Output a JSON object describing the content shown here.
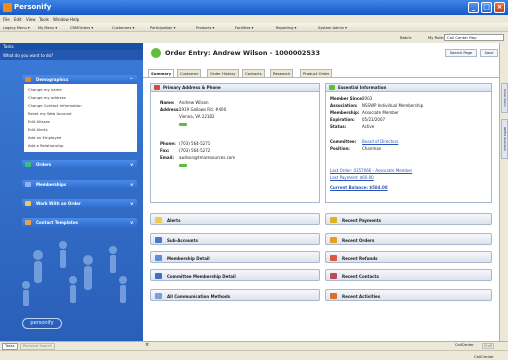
{
  "app": {
    "title": "Personify"
  },
  "menu": [
    "File",
    "Edit",
    "View",
    "Tools",
    "Window",
    "Help"
  ],
  "toolbar": {
    "items": [
      "Legacy Menu ▾",
      "My Menu ▾",
      "CRMOrders ▾",
      "Customers ▾",
      "Participation ▾",
      "Products ▾",
      "Facilities ▾",
      "Reporting ▾",
      "System Admin ▾"
    ],
    "batch_label": "Batch:",
    "role_label": "My Role:",
    "role_value": "Call Center Rep"
  },
  "left_panel": {
    "header": "Tasks",
    "subheader": "What do you want to do?",
    "sections": [
      {
        "label": "Demographics",
        "color": "#e0892e"
      },
      {
        "label": "Orders",
        "color": "#3dbf7a"
      },
      {
        "label": "Memberships",
        "color": "#8ab4f0"
      },
      {
        "label": "Work With an Order",
        "color": "#f2c94c"
      },
      {
        "label": "Contact Templates",
        "color": "#e8a34c"
      }
    ],
    "links": [
      "Change my name",
      "Change my address",
      "Change Contact Information",
      "Reset my Web Account",
      "Edit Aliases",
      "Edit Alerts",
      "Add an Employee",
      "Add a Relationship"
    ],
    "logo": "personify"
  },
  "order": {
    "title": "Order Entry: Andrew Wilson - 1000002533",
    "search_btn": "Search Page",
    "save_btn": "Save",
    "tabs": [
      "Summary",
      "Customer",
      "Order History",
      "Contacts",
      "Research",
      "Product Order"
    ]
  },
  "primary": {
    "title": "Primary Address & Phone",
    "name_label": "Name:",
    "name": "Andrew Wilson",
    "address_label": "Address:",
    "address1": "1919 Gallows Rd. #400",
    "address2": "Vienna, VA 22182",
    "phone_label": "Phone:",
    "phone": "(703) 564-5271",
    "fax_label": "Fax:",
    "fax": "(703) 564-5272",
    "email_label": "Email:",
    "email": "awilson@tmaresources.com"
  },
  "essential": {
    "title": "Essential Information",
    "member_since_label": "Member Since:",
    "member_since": "2003",
    "association_label": "Association:",
    "association": "NSSWP Individual Membership",
    "membership_label": "Membership:",
    "membership": "Associate Member",
    "expiration_label": "Expiration:",
    "expiration": "05/21/2007",
    "status_label": "Status:",
    "status": "Active",
    "committee_label": "Committee:",
    "committee": "Board of Directors",
    "position_label": "Position:",
    "position": "Chairman",
    "last_order": "Last Order: 0357066 - Associate Member",
    "last_payment": "Last Payment: $60.00",
    "current_balance": "Current Balance: $584.00"
  },
  "left_buttons": [
    "Alerts",
    "Sub-Accounts",
    "Membership Detail",
    "Committee Membership Detail",
    "All Communication Methods"
  ],
  "right_buttons": [
    "Recent Payments",
    "Recent Orders",
    "Recent Refunds",
    "Recent Contacts",
    "Recent Activities"
  ],
  "side_tabs": [
    "Order Items",
    "GMOS Assistant"
  ],
  "bottom_tabs": [
    "Tasks",
    "Personal Search"
  ],
  "status": {
    "left": "CallCenter",
    "right": "Staff",
    "footer": "CallCenter"
  }
}
